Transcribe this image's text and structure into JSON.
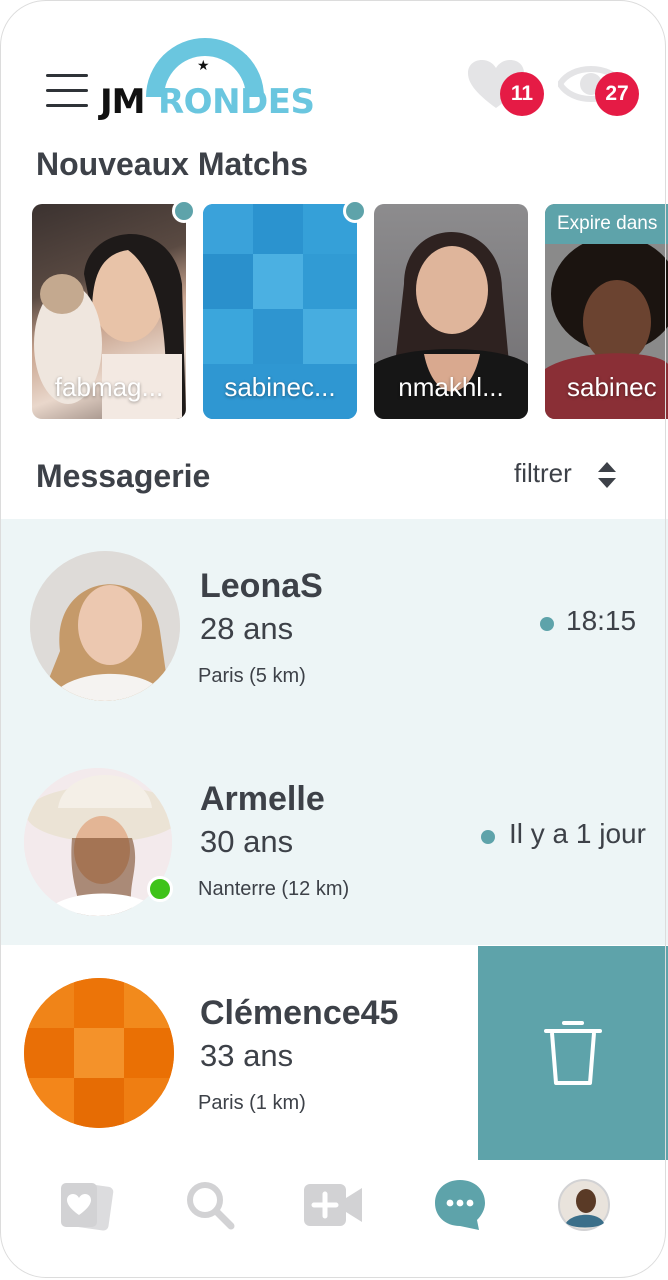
{
  "header": {
    "logo_text_left": "JM",
    "logo_text_right": "RONDES",
    "likes_count": "11",
    "views_count": "27"
  },
  "new_matches": {
    "title": "Nouveaux Matchs",
    "items": [
      {
        "name": "fabmag...",
        "has_dot": true
      },
      {
        "name": "sabinec...",
        "has_dot": true
      },
      {
        "name": "nmakhl...",
        "has_dot": false
      },
      {
        "name": "sabinec",
        "expire_label": "Expire dans",
        "has_dot": false
      }
    ]
  },
  "messaging": {
    "title": "Messagerie",
    "filter_label": "filtrer",
    "conversations": [
      {
        "name": "LeonaS",
        "age": "28 ans",
        "location": "Paris (5 km)",
        "time": "18:15",
        "unread": true
      },
      {
        "name": "Armelle",
        "age": "30 ans",
        "location": "Nanterre (12 km)",
        "time": "Il y a 1 jour",
        "unread": true,
        "online": true
      },
      {
        "name": "Clémence45",
        "age": "33 ans",
        "location": "Paris (1 km)",
        "time": "",
        "unread": false
      }
    ]
  },
  "icons": {
    "menu": "hamburger-icon",
    "likes": "heart-icon",
    "views": "eye-icon",
    "filter": "sort-arrows-icon",
    "delete": "trash-icon",
    "tab_cards": "cards-heart-icon",
    "tab_search": "search-icon",
    "tab_video": "video-plus-icon",
    "tab_messages": "chat-bubble-icon",
    "tab_profile": "profile-avatar"
  },
  "colors": {
    "teal": "#5ea3aa",
    "badge_red": "#e51b45",
    "logo_blue": "#6ac6df",
    "unread_bg": "#edf5f6",
    "online_green": "#3fc31a"
  }
}
